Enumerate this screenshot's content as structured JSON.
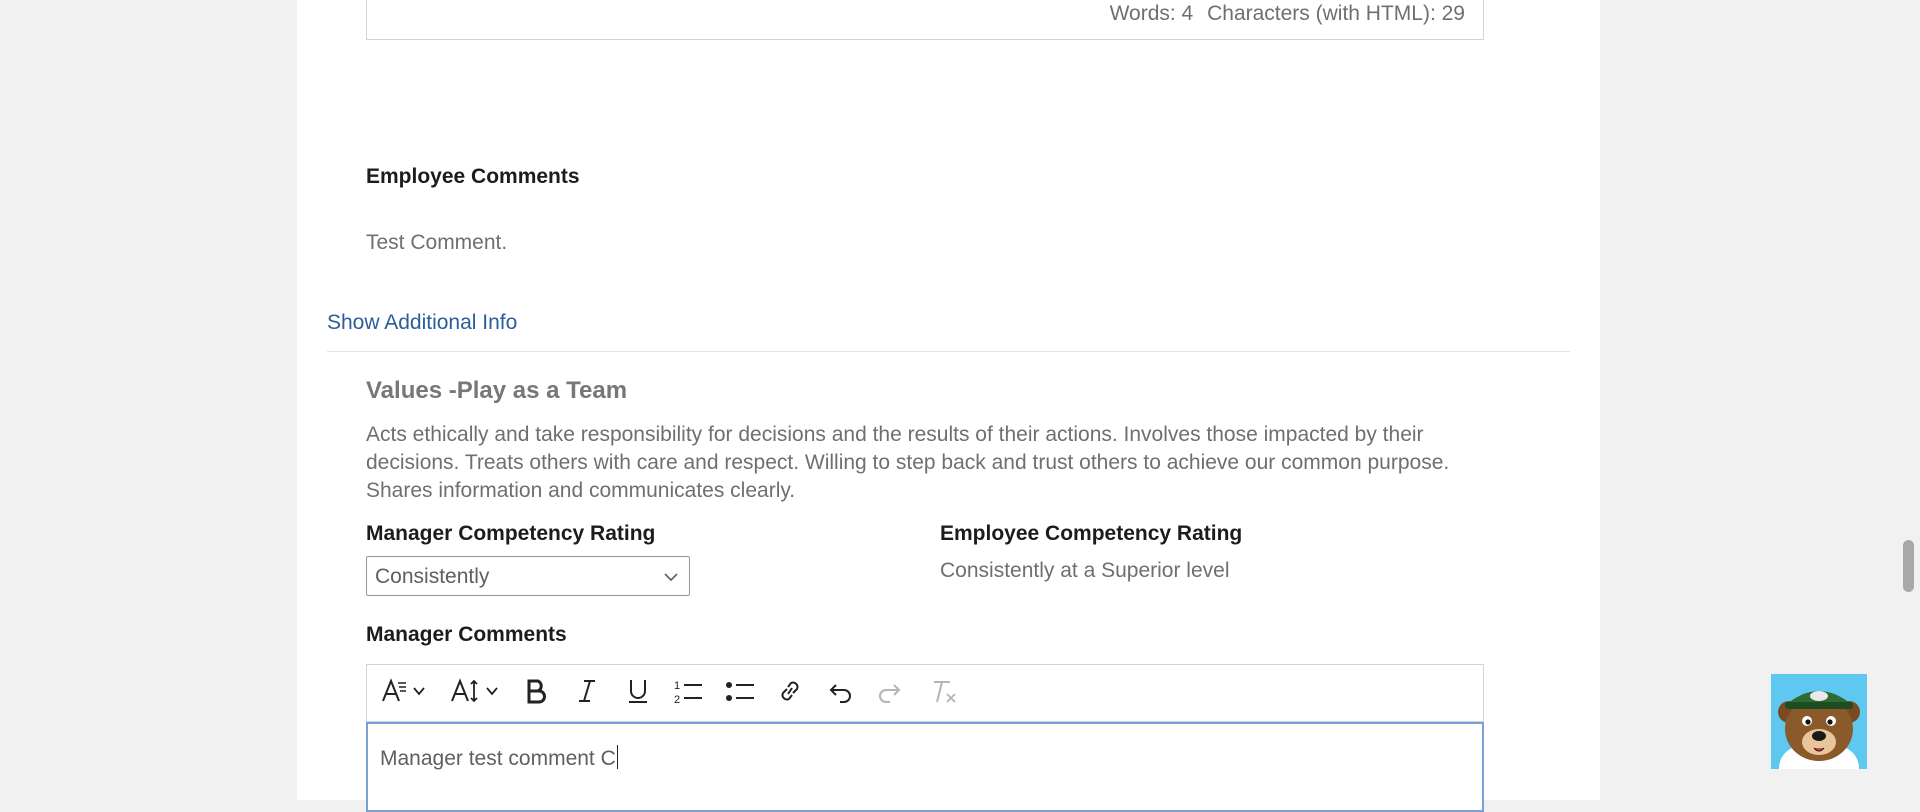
{
  "editor_stats": {
    "words": "Words: 4",
    "characters": "Characters (with HTML): 29"
  },
  "employee_comments": {
    "label": "Employee Comments",
    "text": "Test Comment."
  },
  "show_additional_info": "Show Additional Info",
  "competency": {
    "title": "Values -Play as a Team",
    "description": "Acts ethically and take responsibility for decisions and the results of their actions. Involves those impacted by their decisions. Treats others with care and respect. Willing to step back and trust others to achieve our common purpose. Shares information and communicates clearly.",
    "manager_rating_label": "Manager Competency Rating",
    "manager_rating_value": "Consistently",
    "employee_rating_label": "Employee Competency Rating",
    "employee_rating_value": "Consistently at a Superior level"
  },
  "manager_comments": {
    "label": "Manager Comments",
    "editor_text": "Manager test comment C"
  },
  "toolbar_icons": [
    "font-style-icon",
    "font-size-icon",
    "bold-icon",
    "italic-icon",
    "underline-icon",
    "ordered-list-icon",
    "bullet-list-icon",
    "link-icon",
    "undo-icon",
    "redo-icon",
    "clear-format-icon"
  ],
  "colors": {
    "link": "#2a5d9a",
    "focus_border": "#7aa0d6",
    "mascot_bg": "#5ec8f0"
  }
}
